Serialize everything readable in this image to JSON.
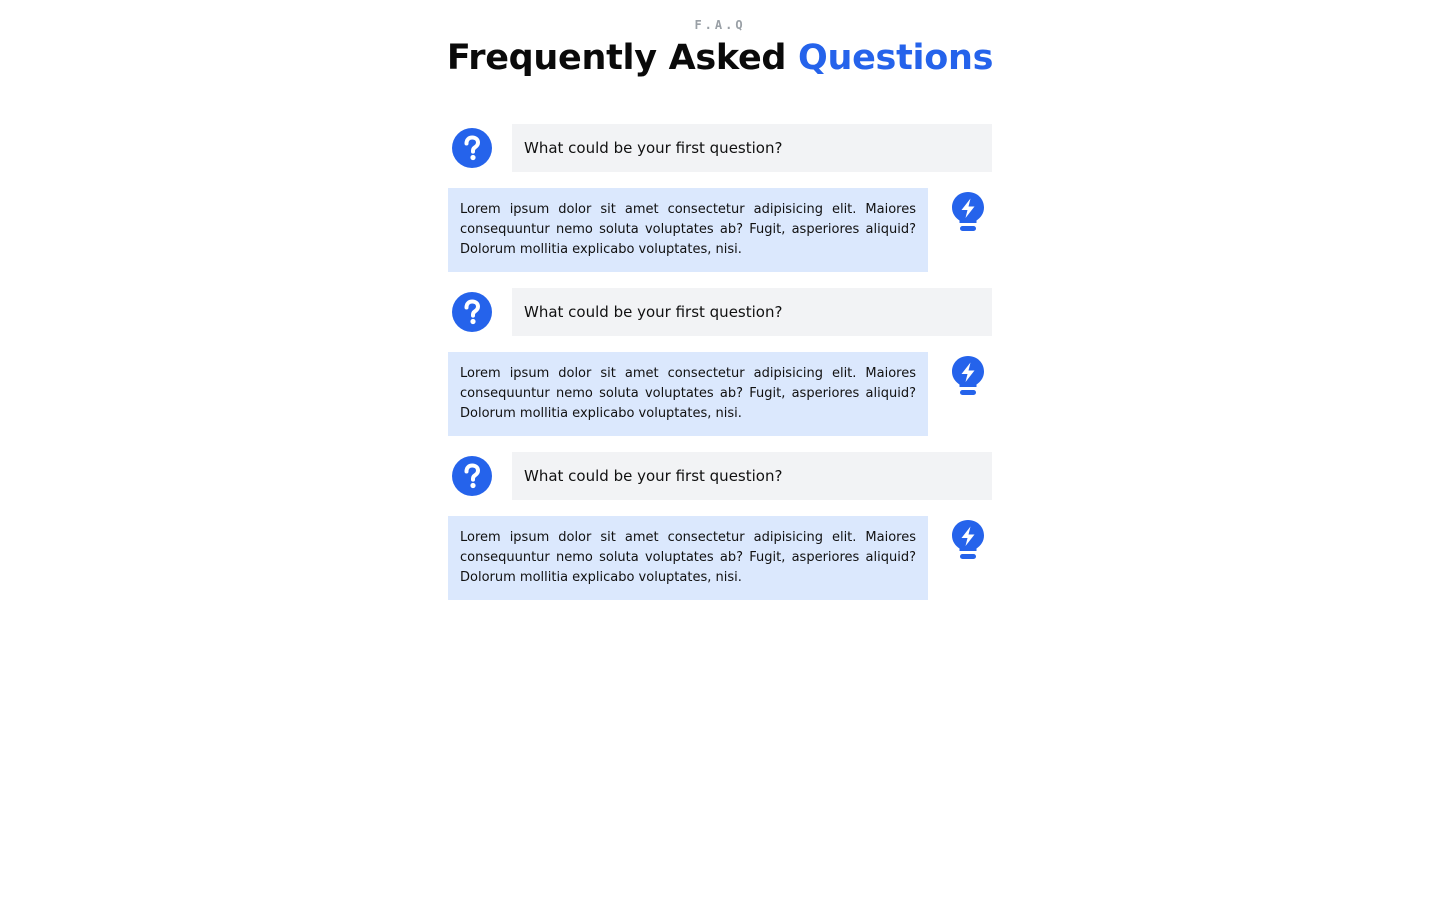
{
  "header": {
    "eyebrow": "F.A.Q",
    "title_main": "Frequently Asked",
    "title_accent": "Questions"
  },
  "colors": {
    "accent": "#2563eb",
    "question_bg": "#f2f3f5",
    "answer_bg": "#dbe8fd"
  },
  "icons": {
    "question": "question-circle-icon",
    "answer": "lightbulb-bolt-icon"
  },
  "faq": [
    {
      "question": "What could be your first question?",
      "answer": "Lorem ipsum dolor sit amet consectetur adipisicing elit. Maiores consequuntur nemo soluta voluptates ab? Fugit, asperiores aliquid? Dolorum mollitia explicabo voluptates, nisi."
    },
    {
      "question": "What could be your first question?",
      "answer": "Lorem ipsum dolor sit amet consectetur adipisicing elit. Maiores consequuntur nemo soluta voluptates ab? Fugit, asperiores aliquid? Dolorum mollitia explicabo voluptates, nisi."
    },
    {
      "question": "What could be your first question?",
      "answer": "Lorem ipsum dolor sit amet consectetur adipisicing elit. Maiores consequuntur nemo soluta voluptates ab? Fugit, asperiores aliquid? Dolorum mollitia explicabo voluptates, nisi."
    }
  ]
}
